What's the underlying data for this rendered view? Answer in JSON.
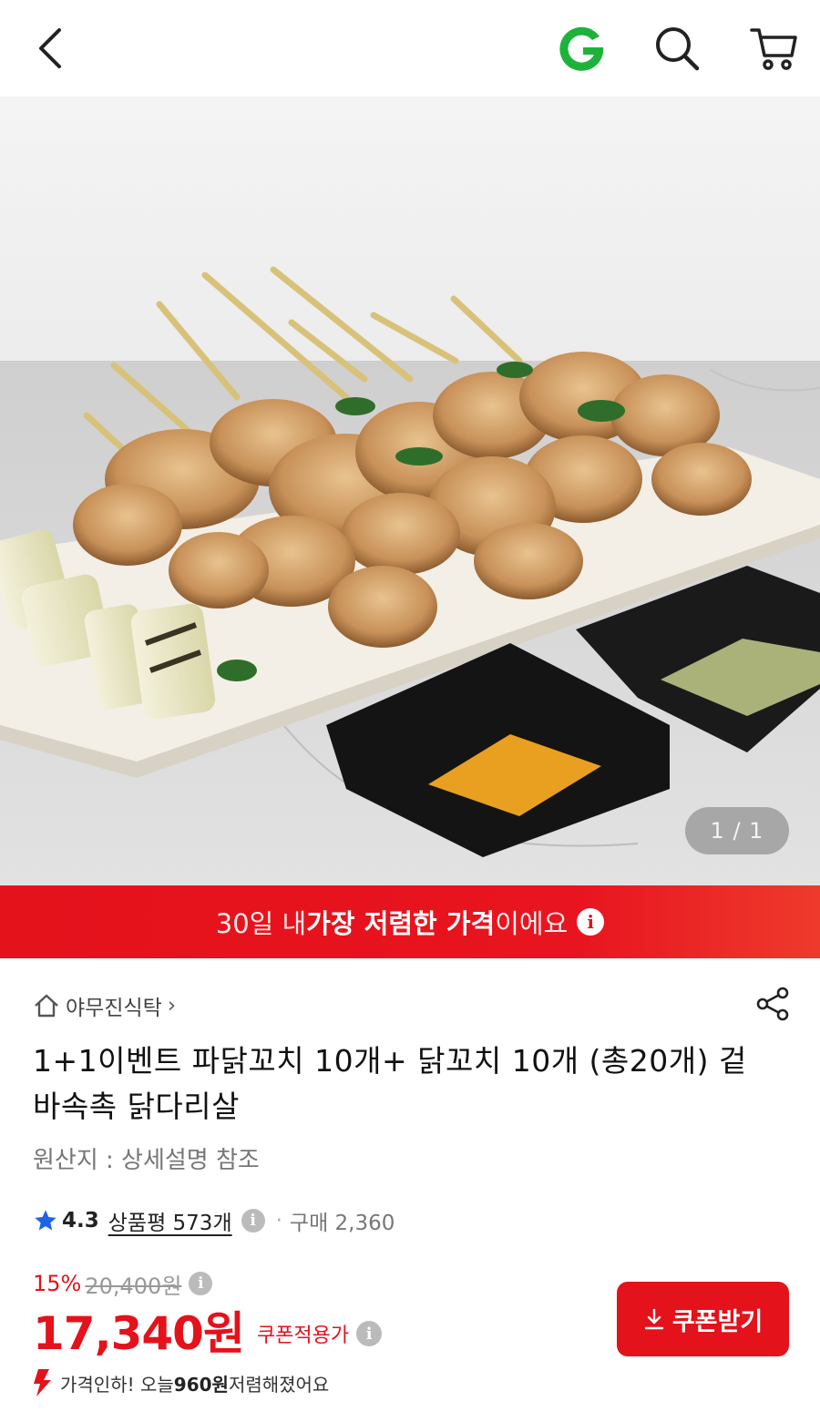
{
  "topbar": {
    "icons": [
      "chevron-left-icon",
      "gmarket-g-logo",
      "search-icon",
      "cart-icon"
    ],
    "logo_letter": "G"
  },
  "hero": {
    "pager": "1 / 1"
  },
  "banner": {
    "text_prefix": "30일 내 ",
    "text_strong": "가장 저렴한 가격",
    "text_suffix": "이에요",
    "info_glyph": "i"
  },
  "product": {
    "seller": "야무진식탁",
    "seller_chevron": "›",
    "title": "1+1이벤트 파닭꼬치 10개+ 닭꼬치 10개 (총20개) 겉바속촉 닭다리살",
    "origin": "원산지 : 상세설명 참조",
    "rating": "4.3",
    "reviews_label": "상품평 573개",
    "purchase_label": "구매 2,360",
    "dot": "·",
    "discount_percent": "15%",
    "original_price": "20,400원",
    "price": "17,340원",
    "coupon_note": "쿠폰적용가",
    "coupon_button": "쿠폰받기",
    "price_drop_prefix": "가격인하! 오늘 ",
    "price_drop_amount": "960원",
    "price_drop_suffix": " 저렴해졌어요"
  },
  "colors": {
    "accent": "#e4121b",
    "logo_green": "#1db33b",
    "star_blue": "#1e64e6"
  }
}
